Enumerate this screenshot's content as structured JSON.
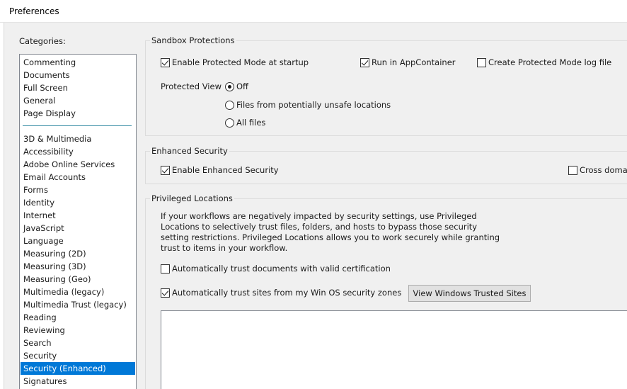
{
  "window": {
    "title": "Preferences"
  },
  "categories": {
    "label": "Categories:",
    "group1": [
      "Commenting",
      "Documents",
      "Full Screen",
      "General",
      "Page Display"
    ],
    "group2": [
      "3D & Multimedia",
      "Accessibility",
      "Adobe Online Services",
      "Email Accounts",
      "Forms",
      "Identity",
      "Internet",
      "JavaScript",
      "Language",
      "Measuring (2D)",
      "Measuring (3D)",
      "Measuring (Geo)",
      "Multimedia (legacy)",
      "Multimedia Trust (legacy)",
      "Reading",
      "Reviewing",
      "Search",
      "Security",
      "Security (Enhanced)",
      "Signatures"
    ],
    "selected": "Security (Enhanced)"
  },
  "sandbox": {
    "title": "Sandbox Protections",
    "protected_mode": {
      "label": "Enable Protected Mode at startup",
      "checked": true
    },
    "app_container": {
      "label": "Run in AppContainer",
      "checked": true
    },
    "log_file": {
      "label": "Create Protected Mode log file",
      "checked": false
    },
    "protected_view_label": "Protected View",
    "protected_view_options": [
      {
        "label": "Off",
        "selected": true
      },
      {
        "label": "Files from potentially unsafe locations",
        "selected": false
      },
      {
        "label": "All files",
        "selected": false
      }
    ]
  },
  "enhanced": {
    "title": "Enhanced Security",
    "enable": {
      "label": "Enable Enhanced Security",
      "checked": true
    },
    "cross_domain": {
      "label": "Cross domai",
      "checked": false
    }
  },
  "privileged": {
    "title": "Privileged Locations",
    "description": "If your workflows are negatively impacted by security settings, use Privileged Locations to selectively trust files, folders, and hosts to bypass those security setting restrictions. Privileged Locations allows you to work securely while granting trust to items in your workflow.",
    "trust_certified": {
      "label": "Automatically trust documents with valid certification",
      "checked": false
    },
    "trust_os_zones": {
      "label": "Automatically trust sites from my Win OS security zones",
      "checked": true
    },
    "view_sites_button": "View Windows Trusted Sites"
  }
}
